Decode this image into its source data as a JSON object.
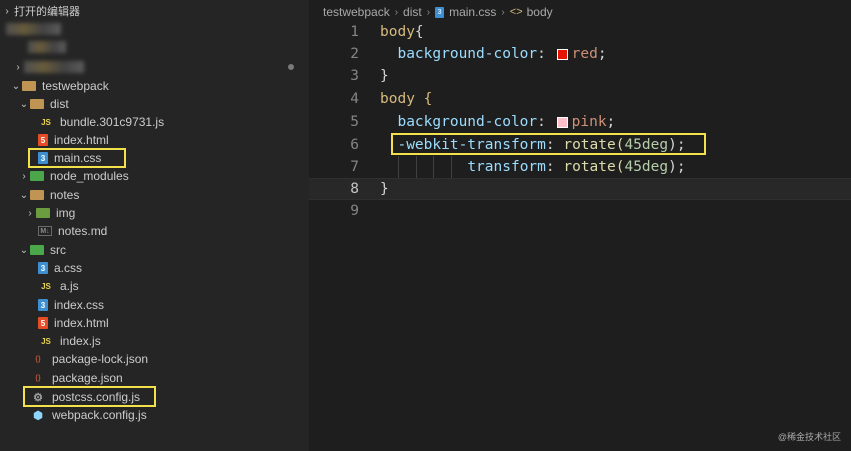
{
  "explorer": {
    "section_title": "打开的编辑器",
    "tree": [
      {
        "label": "testwebpack",
        "kind": "folder"
      },
      {
        "label": "dist",
        "kind": "folder"
      },
      {
        "label": "bundle.301c9731.js",
        "kind": "js"
      },
      {
        "label": "index.html",
        "kind": "html"
      },
      {
        "label": "main.css",
        "kind": "css"
      },
      {
        "label": "node_modules",
        "kind": "folder"
      },
      {
        "label": "notes",
        "kind": "folder"
      },
      {
        "label": "img",
        "kind": "folder"
      },
      {
        "label": "notes.md",
        "kind": "md"
      },
      {
        "label": "src",
        "kind": "folder"
      },
      {
        "label": "a.css",
        "kind": "css"
      },
      {
        "label": "a.js",
        "kind": "js"
      },
      {
        "label": "index.css",
        "kind": "css"
      },
      {
        "label": "index.html",
        "kind": "html"
      },
      {
        "label": "index.js",
        "kind": "js"
      },
      {
        "label": "package-lock.json",
        "kind": "json"
      },
      {
        "label": "package.json",
        "kind": "json"
      },
      {
        "label": "postcss.config.js",
        "kind": "config"
      },
      {
        "label": "webpack.config.js",
        "kind": "webpack"
      }
    ]
  },
  "breadcrumb": [
    "testwebpack",
    "dist",
    "main.css",
    "body"
  ],
  "editor": {
    "line_numbers": [
      "1",
      "2",
      "3",
      "4",
      "5",
      "6",
      "7",
      "8",
      "9"
    ],
    "active_line": "8",
    "line1": {
      "sel": "body",
      "brace": "{"
    },
    "line2": {
      "prop": "background-color",
      "colon": ":",
      "value": "red",
      "semi": ";"
    },
    "line3": {
      "brace": "}"
    },
    "line4": {
      "sel": "body",
      "brace": "{"
    },
    "line5": {
      "prop": "background-color",
      "colon": ":",
      "value": "pink",
      "semi": ";"
    },
    "line6": {
      "prop": "-webkit-transform",
      "colon": ":",
      "fn": "rotate(",
      "num": "45deg",
      "close": ");"
    },
    "line7": {
      "prop": "transform",
      "colon": ":",
      "fn": "rotate(",
      "num": "45deg",
      "close": ");"
    },
    "line8": {
      "brace": "}"
    }
  },
  "colors": {
    "swatch_red": "#e51400",
    "swatch_pink": "#ffc0cb",
    "highlight": "#f2e14a"
  },
  "watermark": "@稀金技术社区"
}
